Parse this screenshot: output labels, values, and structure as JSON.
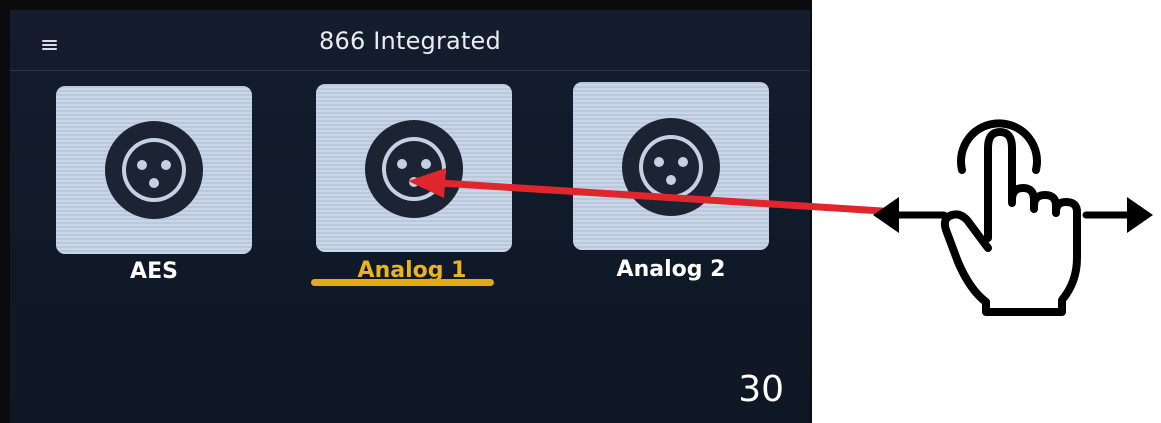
{
  "header": {
    "title": "866 Integrated",
    "menu_icon": "hamburger-menu-icon"
  },
  "inputs": [
    {
      "label": "AES",
      "icon": "xlr-connector-icon",
      "selected": false
    },
    {
      "label": "Analog 1",
      "icon": "xlr-connector-icon",
      "selected": true
    },
    {
      "label": "Analog 2",
      "icon": "xlr-connector-icon",
      "selected": false
    }
  ],
  "footer": {
    "value": "30"
  },
  "annotation": {
    "gesture_icon": "tap-swipe-hand-icon",
    "arrow_icon": "pointer-arrow-icon",
    "arrow_color": "#e0262d"
  },
  "colors": {
    "screen_bg": "#121b2b",
    "tile_bg": "#c3d1e4",
    "selected_accent": "#e4aa13",
    "icon_dark": "#1c2433"
  }
}
